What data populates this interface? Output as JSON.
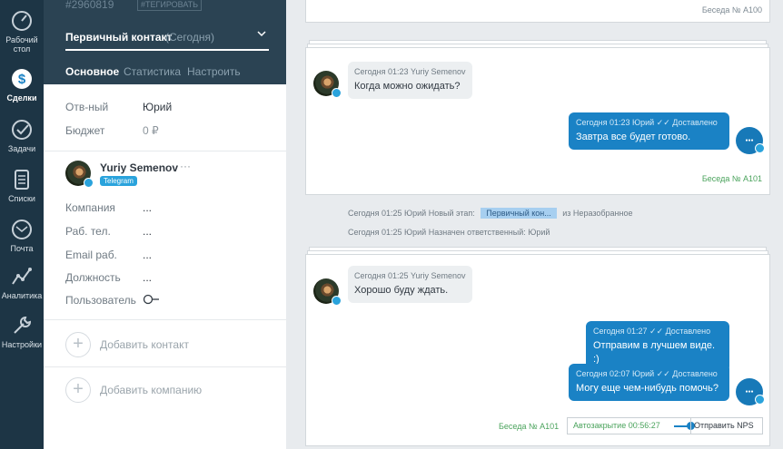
{
  "nav": {
    "items": [
      {
        "label_lines": [
          "Рабочий",
          "стол"
        ],
        "icon": "gauge-icon"
      },
      {
        "label_lines": [
          "Сделки"
        ],
        "icon": "dollar-icon",
        "active": true
      },
      {
        "label_lines": [
          "Задачи"
        ],
        "icon": "checkmark-icon"
      },
      {
        "label_lines": [
          "Списки"
        ],
        "icon": "list-icon"
      },
      {
        "label_lines": [
          "Почта"
        ],
        "icon": "mail-icon"
      },
      {
        "label_lines": [
          "Аналитика"
        ],
        "icon": "analytics-icon"
      },
      {
        "label_lines": [
          "Настройки"
        ],
        "icon": "wrench-icon"
      }
    ]
  },
  "lead": {
    "id": "#2960819",
    "tag_button": "#ТЕГИРОВАТЬ",
    "stage": "Первичный контакт",
    "stage_date": "(Сегодня)",
    "tabs": [
      "Основное",
      "Статистика",
      "Настроить"
    ],
    "fields": [
      {
        "label": "Отв-ный",
        "value": "Юрий"
      },
      {
        "label": "Бюджет",
        "value": "0 ₽"
      }
    ]
  },
  "contact": {
    "name": "Yuriy Semenov",
    "more": "···",
    "source": "Telegram",
    "fields": [
      {
        "label": "Компания",
        "value": "..."
      },
      {
        "label": "Раб. тел.",
        "value": "..."
      },
      {
        "label": "Email раб.",
        "value": "..."
      },
      {
        "label": "Должность",
        "value": "..."
      },
      {
        "label": "Пользователь",
        "value": ""
      }
    ],
    "add_contact": "Добавить контакт",
    "add_company": "Добавить компанию"
  },
  "feed": {
    "card0_conv": "Беседа № А100",
    "card1": {
      "incoming": {
        "meta": "Сегодня 01:23 Yuriy Semenov",
        "text": "Когда можно ожидать?"
      },
      "outgoing": {
        "meta": "Сегодня 01:23 Юрий",
        "status": "✓✓ Доставлено",
        "text": "Завтра все будет готово."
      },
      "conv": "Беседа № А101"
    },
    "events": [
      {
        "time": "Сегодня 01:25",
        "author": "Юрий",
        "action": "Новый этап:",
        "chip": "Первичный кон...",
        "rest": "из Неразобранное"
      },
      {
        "time": "Сегодня 01:25",
        "author": "Юрий",
        "action": "Назначен ответственный: Юрий",
        "chip": "",
        "rest": ""
      }
    ],
    "card2": {
      "incoming": {
        "meta": "Сегодня 01:25 Yuriy Semenov",
        "text": "Хорошо буду ждать."
      },
      "outgoing1": {
        "meta": "Сегодня 01:27",
        "status": "✓✓ Доставлено",
        "text": "Отправим в лучшем виде. :)"
      },
      "outgoing2": {
        "meta": "Сегодня 02:07 Юрий",
        "status": "✓✓ Доставлено",
        "text": "Могу еще чем-нибудь помочь?"
      },
      "conv": "Беседа № А101",
      "autoclose": "Автозакрытие 00:56:27",
      "nps_button": "Отправить NPS"
    }
  },
  "colors": {
    "nav_bg": "#1d3545",
    "panel_head_bg": "#2b4353",
    "outgoing_bubble": "#1a82c5",
    "telegram": "#2aa3dc",
    "conv_green": "#4aa35c"
  }
}
